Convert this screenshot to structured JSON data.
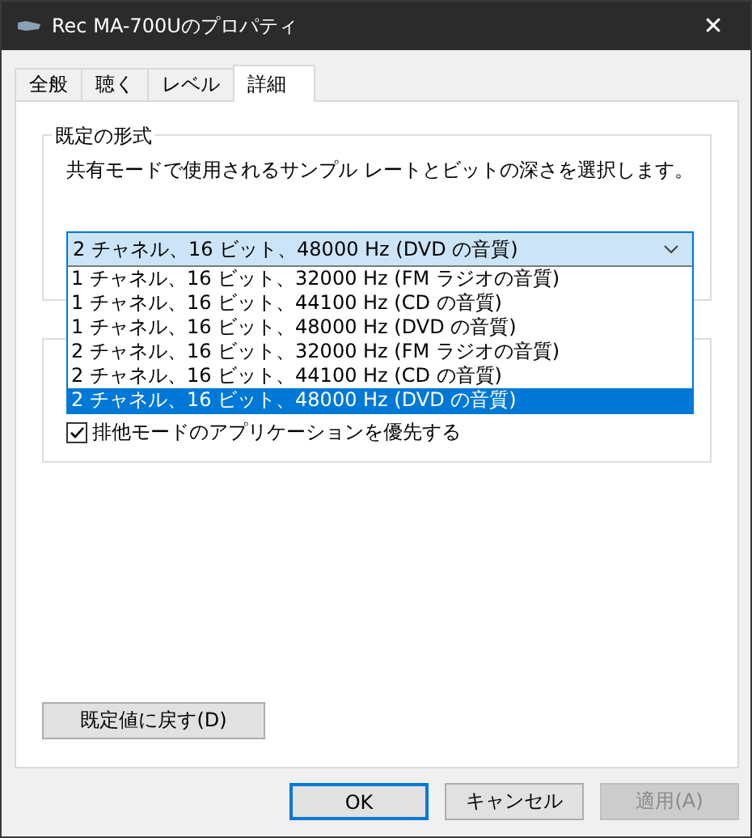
{
  "window": {
    "title": "Rec MA-700Uのプロパティ",
    "close": "✕"
  },
  "tabs": [
    {
      "label": "全般",
      "selected": false
    },
    {
      "label": "聴く",
      "selected": false
    },
    {
      "label": "レベル",
      "selected": false
    },
    {
      "label": "詳細",
      "selected": true
    }
  ],
  "default_format": {
    "legend": "既定の形式",
    "description": "共有モードで使用されるサンプル レートとビットの深さを選択します。",
    "combo": {
      "value": "2 チャネル、16 ビット、48000 Hz (DVD の音質)",
      "expanded": true
    },
    "options": [
      {
        "label": "1 チャネル、16 ビット、32000 Hz (FM ラジオの音質)",
        "selected": false
      },
      {
        "label": "1 チャネル、16 ビット、44100 Hz (CD の音質)",
        "selected": false
      },
      {
        "label": "1 チャネル、16 ビット、48000 Hz (DVD の音質)",
        "selected": false
      },
      {
        "label": "2 チャネル、16 ビット、32000 Hz (FM ラジオの音質)",
        "selected": false
      },
      {
        "label": "2 チャネル、16 ビット、44100 Hz (CD の音質)",
        "selected": false
      },
      {
        "label": "2 チャネル、16 ビット、48000 Hz (DVD の音質)",
        "selected": true
      }
    ]
  },
  "exclusive_mode": {
    "checkboxes": [
      {
        "label": "排他モードのアプリケーションを優先する",
        "checked": true
      }
    ]
  },
  "restore_button": "既定値に戻す(D)",
  "buttons": [
    {
      "label": "OK",
      "default": true,
      "disabled": false
    },
    {
      "label": "キャンセル",
      "default": false,
      "disabled": false
    },
    {
      "label": "適用(A)",
      "default": false,
      "disabled": true
    }
  ]
}
